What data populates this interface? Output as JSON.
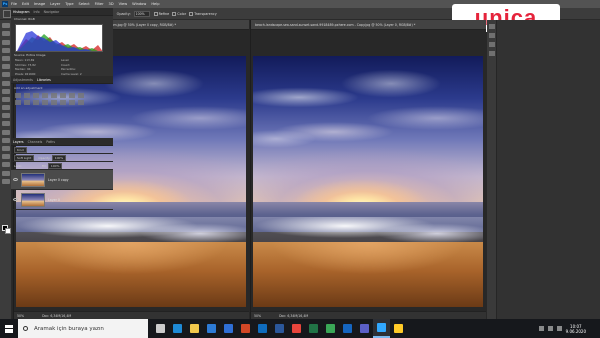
{
  "menu": {
    "items": [
      "File",
      "Edit",
      "Image",
      "Layer",
      "Type",
      "Select",
      "Filter",
      "3D",
      "View",
      "Window",
      "Help"
    ]
  },
  "options": {
    "feather_label": "Feather:",
    "feather_value": "0 px",
    "style_label": "Style:",
    "style_value": "Normal",
    "opacity_label": "Opacity:",
    "opacity_value": "100%",
    "refine_label": "Refine",
    "color_label": "Color",
    "transparency_label": "Transparency"
  },
  "logo": {
    "text": "unica",
    "color": "#e5233b"
  },
  "documents": [
    {
      "tab": "beach-landscape-sea-sand-sunset-sand-9918489-pxhere.com.jpg @ 50% (Layer 0 copy, RGB/8#) *",
      "zoom": "50%",
      "doc_size": "Doc: 6,34M/16,4M"
    },
    {
      "tab": "beach-landscape-sea-sand-sunset-sand-9918489-pxhere.com - Copy.jpg @ 50% (Layer 0, RGB/8#) *",
      "zoom": "50%",
      "doc_size": "Doc: 6,34M/16,4M"
    }
  ],
  "histogram": {
    "tabs": [
      "Histogram",
      "Info",
      "Navigator"
    ],
    "channel_label": "Channel:",
    "channel_value": "RGB",
    "source_label": "Source:",
    "source_value": "Entire Image",
    "stats": [
      [
        "Mean:",
        "113,69"
      ],
      [
        "Level:",
        ""
      ],
      [
        "Std Dev:",
        "73,82"
      ],
      [
        "Count:",
        ""
      ],
      [
        "Median:",
        "94"
      ],
      [
        "Percentile:",
        ""
      ],
      [
        "Pixels:",
        "921600"
      ],
      [
        "Cache Level:",
        "2"
      ]
    ],
    "colors": [
      "#d42020",
      "#1fa01f",
      "#2a36d8"
    ]
  },
  "adjustments": {
    "tabs": [
      "Adjustments",
      "Libraries"
    ],
    "add_label": "Add an adjustment"
  },
  "layers": {
    "tabs": [
      "Layers",
      "Channels",
      "Paths"
    ],
    "kind_label": "Kind",
    "blend_mode": "Soft Light",
    "opacity_label": "Opacity:",
    "opacity_value": "100%",
    "lock_label": "Lock:",
    "fill_label": "Fill:",
    "fill_value": "100%",
    "items": [
      {
        "name": "Layer 0 copy",
        "selected": true
      },
      {
        "name": "Layer 0",
        "selected": false
      }
    ]
  },
  "taskbar": {
    "search_placeholder": "Aramak için buraya yazın",
    "apps": [
      "Task View",
      "Edge",
      "File Explorer",
      "Store",
      "Mail",
      "PowerPoint",
      "Outlook",
      "Word",
      "Chrome",
      "Excel",
      "Edge Beta",
      "Zalo",
      "Teams",
      "Photoshop",
      "Explorer"
    ],
    "app_colors": [
      "#cccccc",
      "#1e8ad6",
      "#f2c94c",
      "#2d7bd6",
      "#2f6fd6",
      "#d24726",
      "#0f6cbd",
      "#2b579a",
      "#e8453c",
      "#217346",
      "#3aa757",
      "#1565c0",
      "#5b5fc7",
      "#31a8ff",
      "#ffca28"
    ],
    "time": "10:07",
    "date": "9.06.2020"
  }
}
